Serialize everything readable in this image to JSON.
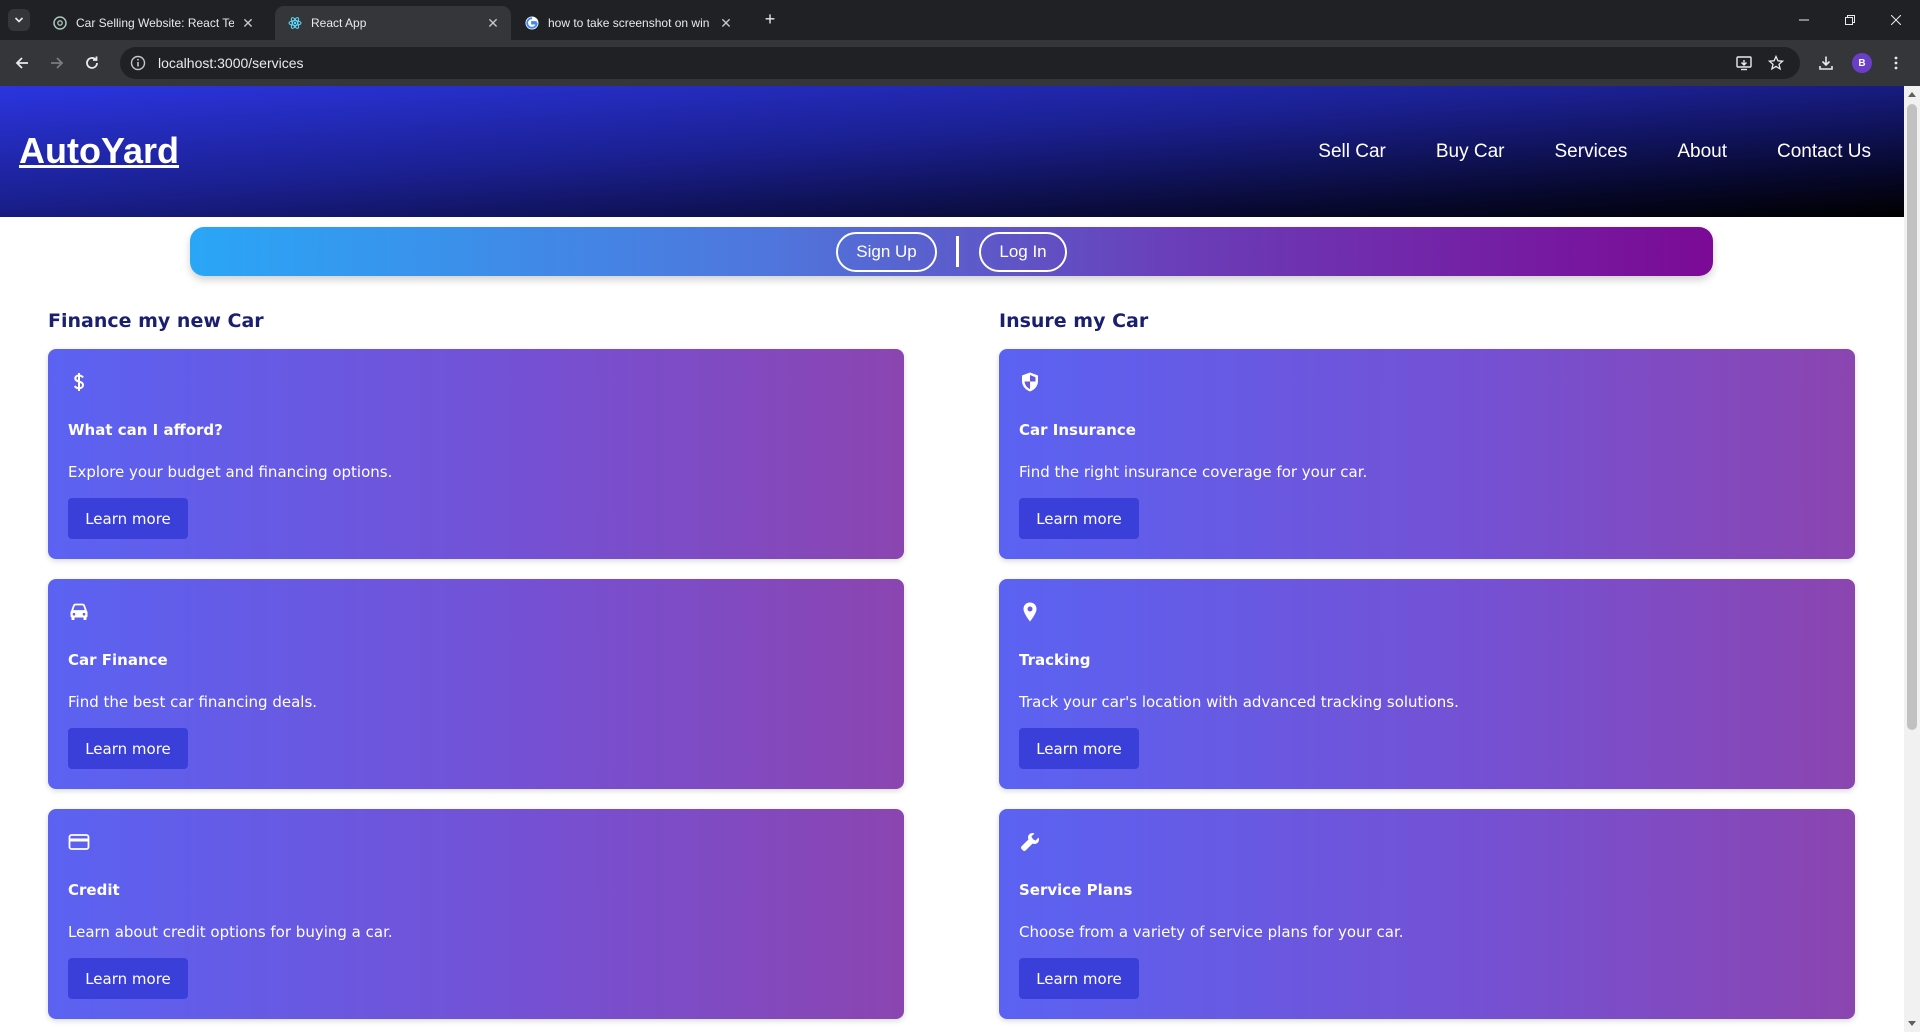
{
  "browser": {
    "tabs": [
      {
        "title": "Car Selling Website: React Tem",
        "favicon": "chatgpt-icon",
        "active": false
      },
      {
        "title": "React App",
        "favicon": "react-icon",
        "active": true
      },
      {
        "title": "how to take screenshot on win",
        "favicon": "google-icon",
        "active": false
      }
    ],
    "url": "localhost:3000/services",
    "profile_initial": "B"
  },
  "site": {
    "brand": "AutoYard",
    "nav": [
      "Sell Car",
      "Buy Car",
      "Services",
      "About",
      "Contact Us"
    ],
    "auth": {
      "signup": "Sign Up",
      "login": "Log In"
    }
  },
  "sections": [
    {
      "title": "Finance my new Car",
      "cards": [
        {
          "icon": "dollar-icon",
          "title": "What can I afford?",
          "description": "Explore your budget and financing options.",
          "button": "Learn more"
        },
        {
          "icon": "car-icon",
          "title": "Car Finance",
          "description": "Find the best car financing deals.",
          "button": "Learn more"
        },
        {
          "icon": "credit-card-icon",
          "title": "Credit",
          "description": "Learn about credit options for buying a car.",
          "button": "Learn more"
        }
      ]
    },
    {
      "title": "Insure my Car",
      "cards": [
        {
          "icon": "shield-icon",
          "title": "Car Insurance",
          "description": "Find the right insurance coverage for your car.",
          "button": "Learn more"
        },
        {
          "icon": "map-pin-icon",
          "title": "Tracking",
          "description": "Track your car's location with advanced tracking solutions.",
          "button": "Learn more"
        },
        {
          "icon": "wrench-icon",
          "title": "Service Plans",
          "description": "Choose from a variety of service plans for your car.",
          "button": "Learn more"
        }
      ]
    }
  ],
  "colors": {
    "header_gradient": [
      "#2b35e0",
      "#000000"
    ],
    "auth_gradient": [
      "#2aa6f6",
      "#7b0a96"
    ],
    "card_gradient": [
      "#5b62f2",
      "#8b45b0"
    ],
    "button": "#3b3fd9",
    "section_title": "#1a1f6e"
  }
}
